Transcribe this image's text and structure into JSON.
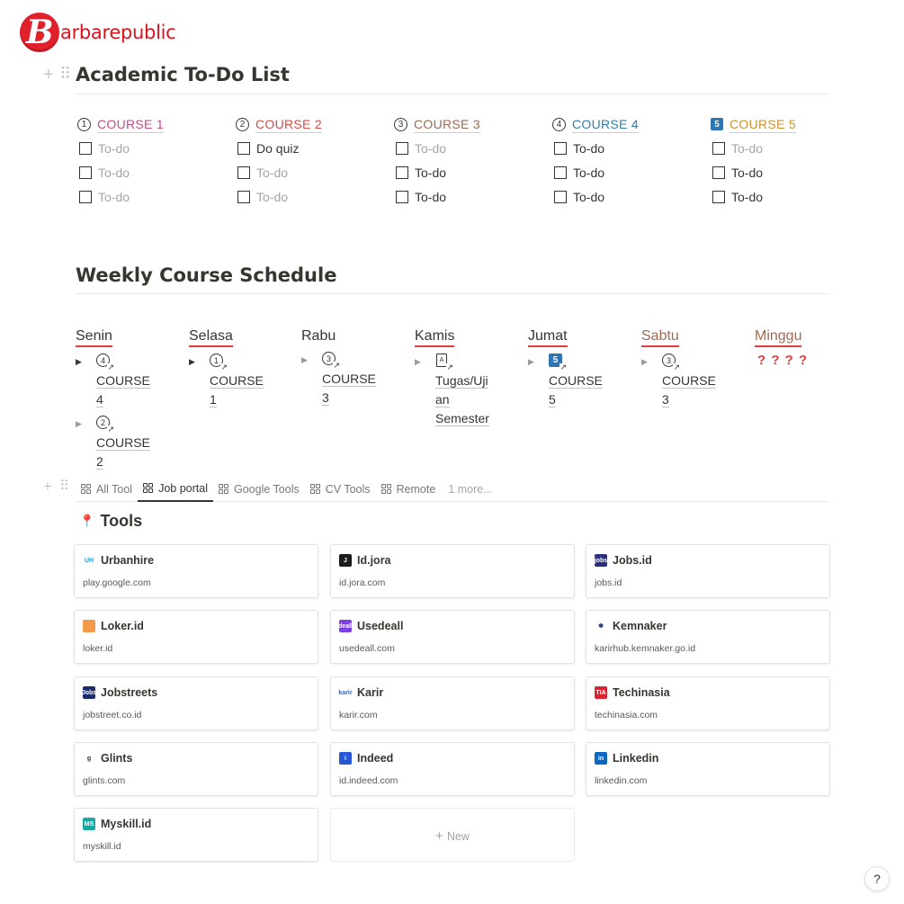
{
  "brand": {
    "logo_letter": "B",
    "name": "arbarepublic",
    "color": "#d8141e"
  },
  "todo_section": {
    "title": "Academic To-Do List",
    "courses": [
      {
        "num": "1",
        "icon": "circle-1-icon",
        "title": "COURSE 1",
        "color": "#c14c8a",
        "items": [
          {
            "text": "To-do",
            "muted": true
          },
          {
            "text": "To-do",
            "muted": true
          },
          {
            "text": "To-do",
            "muted": true
          }
        ]
      },
      {
        "num": "2",
        "icon": "circle-2-icon",
        "title": "COURSE 2",
        "color": "#d44c47",
        "items": [
          {
            "text": "Do quiz",
            "muted": false
          },
          {
            "text": "To-do",
            "muted": true
          },
          {
            "text": "To-do",
            "muted": true
          }
        ]
      },
      {
        "num": "3",
        "icon": "circle-3-icon",
        "title": "COURSE 3",
        "color": "#9f6b53",
        "items": [
          {
            "text": "To-do",
            "muted": true
          },
          {
            "text": "To-do",
            "muted": false
          },
          {
            "text": "To-do",
            "muted": false
          }
        ]
      },
      {
        "num": "4",
        "icon": "circle-4-icon",
        "title": "COURSE 4",
        "color": "#337ea9",
        "items": [
          {
            "text": "To-do",
            "muted": false
          },
          {
            "text": "To-do",
            "muted": false
          },
          {
            "text": "To-do",
            "muted": false
          }
        ]
      },
      {
        "num": "5",
        "icon": "square-5-icon",
        "title": "COURSE 5",
        "color": "#cb912f",
        "items": [
          {
            "text": "To-do",
            "muted": true
          },
          {
            "text": "To-do",
            "muted": false
          },
          {
            "text": "To-do",
            "muted": false
          }
        ]
      }
    ]
  },
  "schedule": {
    "title": "Weekly Course Schedule",
    "days": [
      {
        "name": "Senin",
        "color": "#37352f",
        "underline": true,
        "items": [
          {
            "icon": "circle-4-link-icon",
            "num": "4",
            "kind": "circle",
            "lines": [
              "COURSE",
              "4"
            ],
            "expanded": true
          },
          {
            "icon": "circle-2-link-icon",
            "num": "2",
            "kind": "circle",
            "lines": [
              "COURSE",
              "2"
            ],
            "expanded": false
          }
        ]
      },
      {
        "name": "Selasa",
        "color": "#37352f",
        "underline": true,
        "items": [
          {
            "icon": "circle-1-link-icon",
            "num": "1",
            "kind": "circle",
            "lines": [
              "COURSE",
              "1"
            ],
            "expanded": true
          }
        ]
      },
      {
        "name": "Rabu",
        "color": "#37352f",
        "underline": false,
        "items": [
          {
            "icon": "circle-3-link-icon",
            "num": "3",
            "kind": "circle",
            "lines": [
              "COURSE",
              "3"
            ],
            "expanded": false
          }
        ]
      },
      {
        "name": "Kamis",
        "color": "#37352f",
        "underline": true,
        "items": [
          {
            "icon": "document-link-icon",
            "num": "A",
            "kind": "doc",
            "lines": [
              "Tugas/Uji",
              "an",
              "Semester"
            ],
            "expanded": false
          }
        ]
      },
      {
        "name": "Jumat",
        "color": "#37352f",
        "underline": true,
        "items": [
          {
            "icon": "square-5-link-icon",
            "num": "5",
            "kind": "square",
            "lines": [
              "COURSE",
              "5"
            ],
            "expanded": false
          }
        ]
      },
      {
        "name": "Sabtu",
        "color": "#9f6b53",
        "underline": true,
        "items": [
          {
            "icon": "circle-3-link-icon",
            "num": "3",
            "kind": "circle",
            "lines": [
              "COURSE",
              "3"
            ],
            "expanded": false
          }
        ]
      },
      {
        "name": "Minggu",
        "color": "#9f6b53",
        "underline": true,
        "marks": "? ? ? ?",
        "items": []
      }
    ]
  },
  "tabs": [
    {
      "label": "All Tool",
      "active": false,
      "icon": "gallery-icon"
    },
    {
      "label": "Job portal",
      "active": true,
      "icon": "gallery-icon"
    },
    {
      "label": "Google Tools",
      "active": false,
      "icon": "gallery-icon"
    },
    {
      "label": "CV Tools",
      "active": false,
      "icon": "gallery-icon"
    },
    {
      "label": "Remote",
      "active": false,
      "icon": "gallery-icon"
    },
    {
      "label": "1 more...",
      "active": false,
      "icon": ""
    }
  ],
  "tools": {
    "title": "Tools",
    "icon": "pushpin-icon",
    "cards": [
      {
        "name": "Urbanhire",
        "url": "play.google.com",
        "icon": "urbanhire-icon",
        "fav_text": "UH",
        "fav_bg": "#ffffff",
        "fav_fg": "#18a0d8"
      },
      {
        "name": "Id.jora",
        "url": "id.jora.com",
        "icon": "jora-icon",
        "fav_text": "J",
        "fav_bg": "#1b1b1b",
        "fav_fg": "#ffffff"
      },
      {
        "name": "Jobs.id",
        "url": "jobs.id",
        "icon": "jobsid-icon",
        "fav_text": "jobs",
        "fav_bg": "#2a2f7a",
        "fav_fg": "#ffffff"
      },
      {
        "name": "Loker.id",
        "url": "loker.id",
        "icon": "lokerid-icon",
        "fav_text": "",
        "fav_bg": "#f39a4a",
        "fav_fg": "#ffffff"
      },
      {
        "name": "Usedeall",
        "url": "usedeall.com",
        "icon": "usedeall-icon",
        "fav_text": "deall",
        "fav_bg": "#7b3fe4",
        "fav_fg": "#ffffff"
      },
      {
        "name": "Kemnaker",
        "url": "karirhub.kemnaker.go.id",
        "icon": "kemnaker-icon",
        "fav_text": "✱",
        "fav_bg": "#ffffff",
        "fav_fg": "#1f3a6a"
      },
      {
        "name": "Jobstreets",
        "url": "jobstreet.co.id",
        "icon": "jobstreet-icon",
        "fav_text": "Jobs",
        "fav_bg": "#1b2b6b",
        "fav_fg": "#ffffff"
      },
      {
        "name": "Karir",
        "url": "karir.com",
        "icon": "karir-icon",
        "fav_text": "karir",
        "fav_bg": "#ffffff",
        "fav_fg": "#1b6ad1"
      },
      {
        "name": "Techinasia",
        "url": "techinasia.com",
        "icon": "techinasia-icon",
        "fav_text": "TIA",
        "fav_bg": "#d9232e",
        "fav_fg": "#ffffff"
      },
      {
        "name": "Glints",
        "url": "glints.com",
        "icon": "glints-icon",
        "fav_text": "g",
        "fav_bg": "#ffffff",
        "fav_fg": "#333333"
      },
      {
        "name": "Indeed",
        "url": "id.indeed.com",
        "icon": "indeed-icon",
        "fav_text": "i",
        "fav_bg": "#2557d6",
        "fav_fg": "#ffffff"
      },
      {
        "name": "Linkedin",
        "url": "linkedin.com",
        "icon": "linkedin-icon",
        "fav_text": "in",
        "fav_bg": "#0a66c2",
        "fav_fg": "#ffffff"
      },
      {
        "name": "Myskill.id",
        "url": "myskill.id",
        "icon": "myskill-icon",
        "fav_text": "MS",
        "fav_bg": "#1aa7a1",
        "fav_fg": "#ffffff"
      }
    ],
    "new_label": "New"
  },
  "help": "?"
}
